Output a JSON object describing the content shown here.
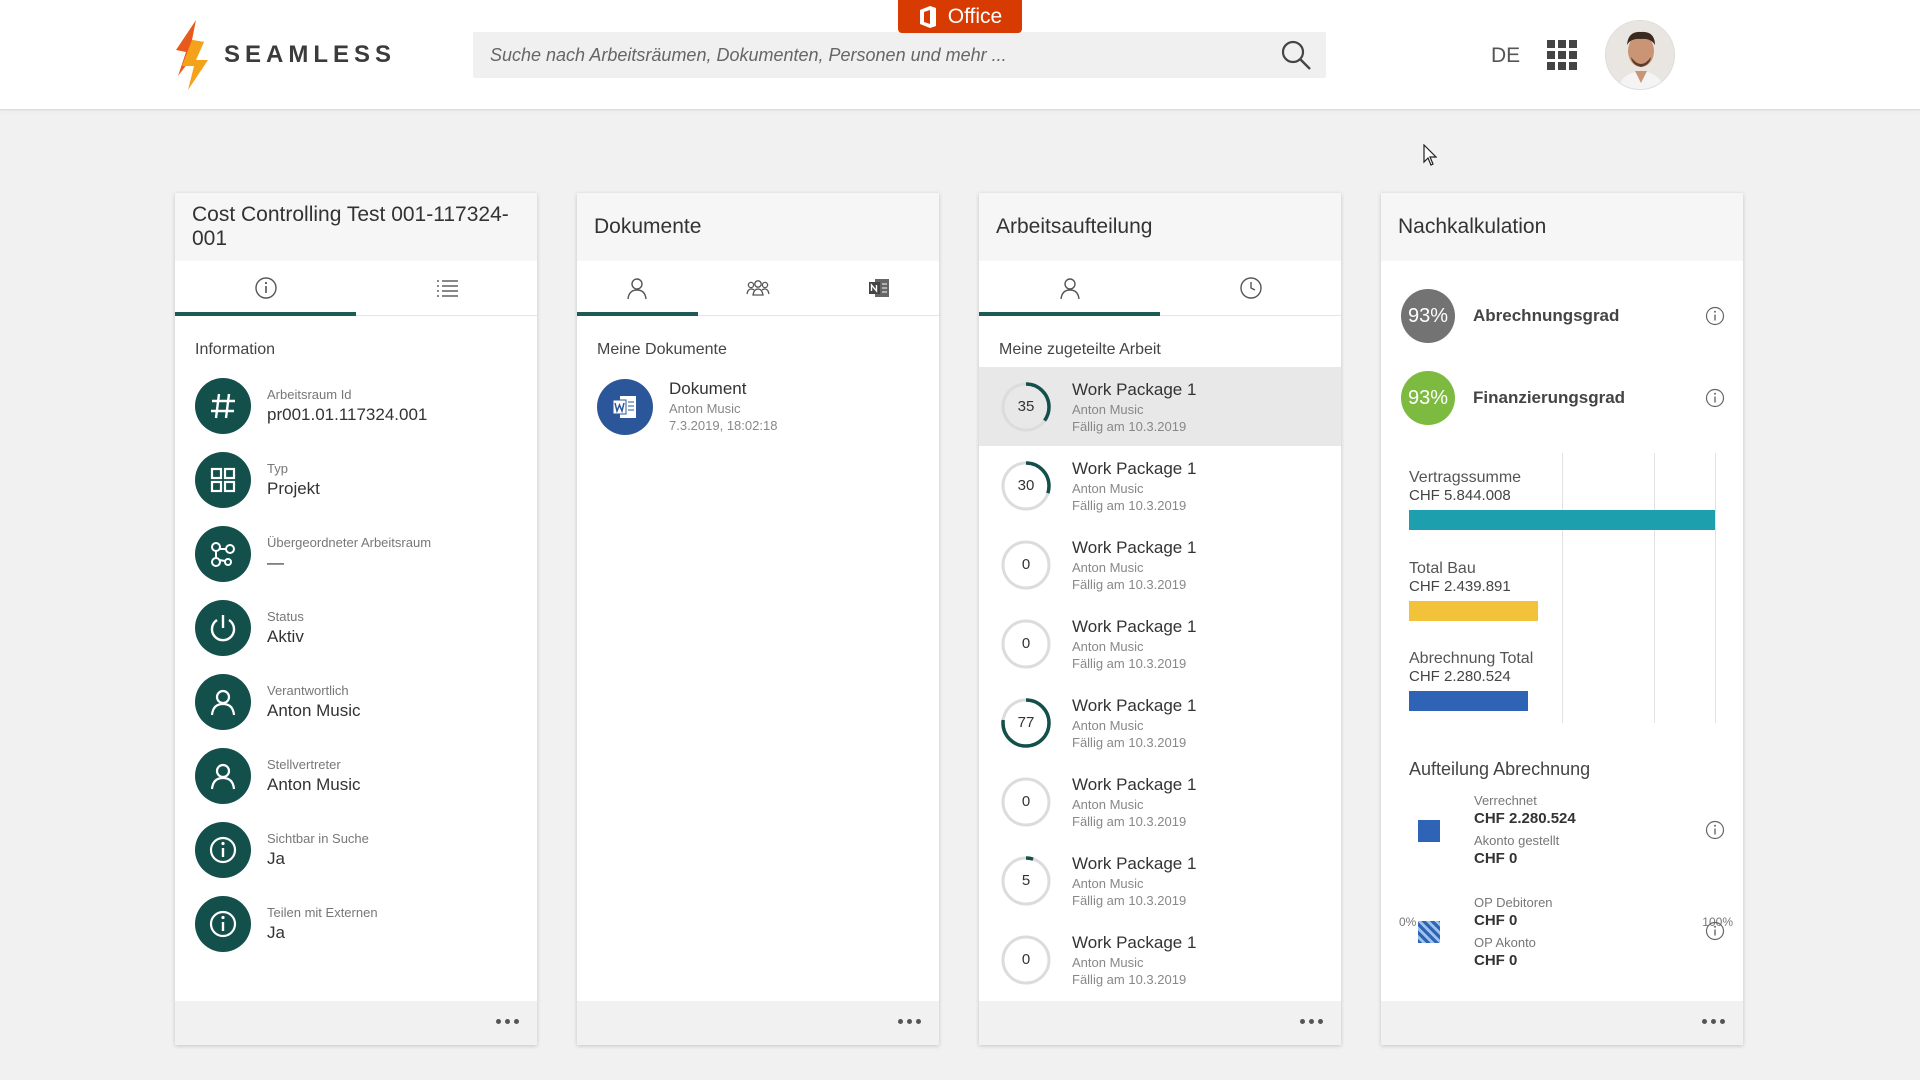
{
  "header": {
    "logo_text": "SEAMLESS",
    "office_label": "Office",
    "search_placeholder": "Suche nach Arbeitsräumen, Dokumenten, Personen und mehr ...",
    "language": "DE"
  },
  "cards": {
    "info": {
      "title": "Cost Controlling Test 001-117324-001",
      "section": "Information",
      "rows": [
        {
          "label": "Arbeitsraum Id",
          "value": "pr001.01.117324.001",
          "icon": "hash-icon"
        },
        {
          "label": "Typ",
          "value": "Projekt",
          "icon": "grid-icon"
        },
        {
          "label": "Übergeordneter Arbeitsraum",
          "value": "—",
          "icon": "hierarchy-icon"
        },
        {
          "label": "Status",
          "value": "Aktiv",
          "icon": "power-icon"
        },
        {
          "label": "Verantwortlich",
          "value": "Anton Music",
          "icon": "person-icon"
        },
        {
          "label": "Stellvertreter",
          "value": "Anton Music",
          "icon": "person-icon"
        },
        {
          "label": "Sichtbar in Suche",
          "value": "Ja",
          "icon": "info-icon"
        },
        {
          "label": "Teilen mit Externen",
          "value": "Ja",
          "icon": "info-icon"
        }
      ]
    },
    "documents": {
      "title": "Dokumente",
      "section": "Meine Dokumente",
      "items": [
        {
          "title": "Dokument",
          "author": "Anton Music",
          "date": "7.3.2019, 18:02:18"
        }
      ]
    },
    "work": {
      "title": "Arbeitsaufteilung",
      "section": "Meine zugeteilte Arbeit",
      "items": [
        {
          "progress": 35,
          "title": "Work Package 1",
          "person": "Anton Music",
          "due": "Fällig am 10.3.2019"
        },
        {
          "progress": 30,
          "title": "Work Package 1",
          "person": "Anton Music",
          "due": "Fällig am 10.3.2019"
        },
        {
          "progress": 0,
          "title": "Work Package 1",
          "person": "Anton Music",
          "due": "Fällig am 10.3.2019"
        },
        {
          "progress": 0,
          "title": "Work Package 1",
          "person": "Anton Music",
          "due": "Fällig am 10.3.2019"
        },
        {
          "progress": 77,
          "title": "Work Package 1",
          "person": "Anton Music",
          "due": "Fällig am 10.3.2019"
        },
        {
          "progress": 0,
          "title": "Work Package 1",
          "person": "Anton Music",
          "due": "Fällig am 10.3.2019"
        },
        {
          "progress": 5,
          "title": "Work Package 1",
          "person": "Anton Music",
          "due": "Fällig am 10.3.2019"
        },
        {
          "progress": 0,
          "title": "Work Package 1",
          "person": "Anton Music",
          "due": "Fällig am 10.3.2019"
        }
      ]
    },
    "costing": {
      "title": "Nachkalkulation",
      "kpis": [
        {
          "value": "93%",
          "label": "Abrechnungsgrad",
          "color": "#737373"
        },
        {
          "value": "93%",
          "label": "Finanzierungsgrad",
          "color": "#7cbb3f"
        }
      ],
      "axis_min": "0%",
      "axis_max": "100%",
      "bars": [
        {
          "label": "Vertragssumme",
          "amount": "CHF 5.844.008",
          "fraction": 1.0,
          "color": "#1e9fad"
        },
        {
          "label": "Total Bau",
          "amount": "CHF 2.439.891",
          "fraction": 0.42,
          "color": "#f2c23a"
        },
        {
          "label": "Abrechnung Total",
          "amount": "CHF 2.280.524",
          "fraction": 0.39,
          "color": "#2e63b6"
        }
      ],
      "split_title": "Aufteilung Abrechnung",
      "split": [
        {
          "label1": "Verrechnet",
          "value1": "CHF 2.280.524",
          "label2": "Akonto gestellt",
          "value2": "CHF 0"
        },
        {
          "label1": "OP Debitoren",
          "value1": "CHF 0",
          "label2": "OP Akonto",
          "value2": "CHF 0"
        }
      ]
    }
  },
  "colors": {
    "accent": "#134f4b",
    "office": "#d83b01",
    "word": "#2b579a"
  }
}
